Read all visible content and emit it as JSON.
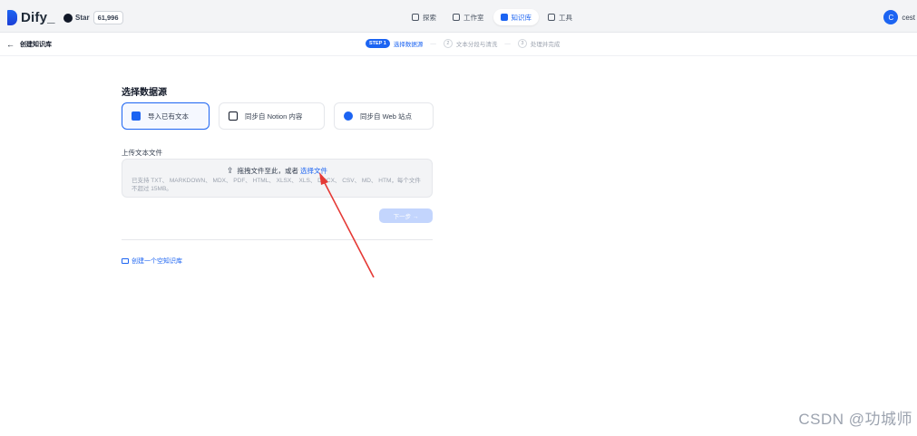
{
  "app": {
    "name": "Dify_"
  },
  "github": {
    "star_label": "Star",
    "star_count": "61,996"
  },
  "nav": [
    {
      "label": "探索",
      "icon": "compass-icon"
    },
    {
      "label": "工作室",
      "icon": "studio-icon"
    },
    {
      "label": "知识库",
      "icon": "book-icon",
      "active": true
    },
    {
      "label": "工具",
      "icon": "tools-icon"
    }
  ],
  "user": {
    "initial": "C",
    "name": "cest"
  },
  "subbar": {
    "back_label": "创建知识库",
    "steps": {
      "step1_badge": "STEP 1",
      "step1_label": "选择数据源",
      "step2_num": "2",
      "step2_label": "文本分段与清洗",
      "step3_num": "3",
      "step3_label": "处理并完成"
    }
  },
  "main": {
    "section_title": "选择数据源",
    "sources": [
      {
        "label": "导入已有文本",
        "icon": "document-icon",
        "active": true
      },
      {
        "label": "同步自 Notion 内容",
        "icon": "notion-icon"
      },
      {
        "label": "同步自 Web 站点",
        "icon": "web-icon"
      }
    ],
    "upload_title": "上传文本文件",
    "drop_text": "拖拽文件至此，或者",
    "drop_link": "选择文件",
    "drop_hint": "已支持 TXT、 MARKDOWN、 MDX、 PDF、 HTML、 XLSX、 XLS、 DOCX、 CSV、 MD、 HTM，每个文件不超过 15MB。",
    "next_label": "下一步 →",
    "empty_kb_label": "创建一个空知识库"
  },
  "watermark": "CSDN @功城师",
  "colors": {
    "accent": "#1c64f2",
    "annotation": "#e53935"
  }
}
